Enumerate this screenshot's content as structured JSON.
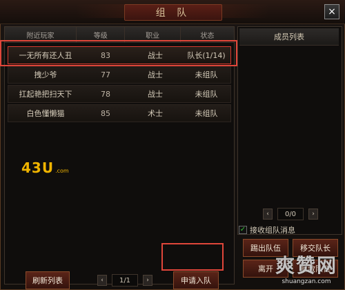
{
  "window": {
    "title": "组 队",
    "close_icon": "×"
  },
  "nearby": {
    "headers": [
      "附近玩家",
      "等级",
      "职业",
      "状态"
    ],
    "rows": [
      {
        "name": "一无所有还人丑",
        "level": "83",
        "class": "战士",
        "status": "队长(1/14)"
      },
      {
        "name": "拽少爷",
        "level": "77",
        "class": "战士",
        "status": "未组队"
      },
      {
        "name": "扛起艳把扫天下",
        "level": "78",
        "class": "战士",
        "status": "未组队"
      },
      {
        "name": "白色懂懒猫",
        "level": "85",
        "class": "术士",
        "status": "未组队"
      }
    ],
    "logo": {
      "text": "43U",
      "suffix": ".com"
    }
  },
  "left_footer": {
    "refresh_label": "刷新列表",
    "page": "1/1",
    "prev_icon": "‹",
    "next_icon": "›",
    "apply_label": "申请入队"
  },
  "members": {
    "header": "成员列表",
    "page": "0/0",
    "prev_icon": "‹",
    "next_icon": "›"
  },
  "options": {
    "receive_team_msg_label": "接收组队消息",
    "receive_team_msg_checked": true,
    "check_icon": "✓"
  },
  "team_actions": {
    "kick_label": "踢出队伍",
    "transfer_label": "移交队长",
    "leave_label": "离开",
    "disband_label": "解散队伍"
  },
  "watermark": {
    "main": "爽赞网",
    "sub": "shuangzan.com"
  }
}
